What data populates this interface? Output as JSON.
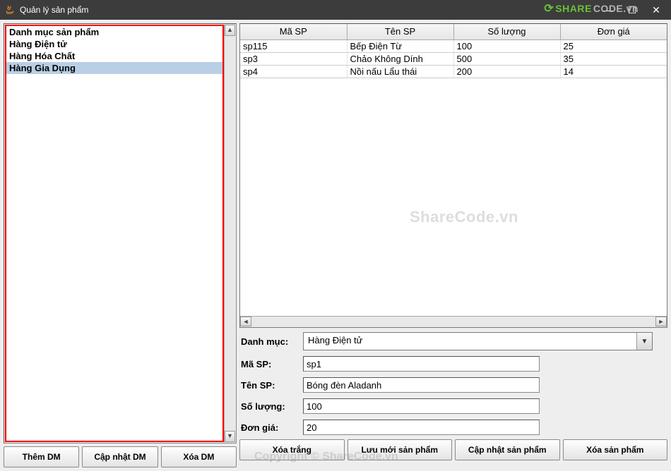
{
  "window": {
    "title": "Quản lý sản phẩm"
  },
  "categories": {
    "items": [
      {
        "label": "Danh mục sản phẩm",
        "selected": false
      },
      {
        "label": "Hàng Điện tử",
        "selected": false
      },
      {
        "label": "Hàng Hóa Chất",
        "selected": false
      },
      {
        "label": "Hàng Gia Dụng",
        "selected": true
      }
    ]
  },
  "left_buttons": {
    "add": "Thêm DM",
    "update": "Cập nhật DM",
    "delete": "Xóa DM"
  },
  "table": {
    "columns": [
      "Mã SP",
      "Tên SP",
      "Số lượng",
      "Đơn giá"
    ],
    "rows": [
      {
        "c0": "sp115",
        "c1": "Bếp Điện Từ",
        "c2": "100",
        "c3": "25"
      },
      {
        "c0": "sp3",
        "c1": "Chảo Không Dính",
        "c2": "500",
        "c3": "35"
      },
      {
        "c0": "sp4",
        "c1": "Nồi nấu Lẩu thái",
        "c2": "200",
        "c3": "14"
      }
    ]
  },
  "form": {
    "category_label": "Danh mục:",
    "category_value": "Hàng Điện tử",
    "code_label": "Mã SP:",
    "code_value": "sp1",
    "name_label": "Tên SP:",
    "name_value": "Bóng đèn Aladanh",
    "qty_label": "Số lượng:",
    "qty_value": "100",
    "price_label": "Đơn giá:",
    "price_value": "20"
  },
  "right_buttons": {
    "clear": "Xóa trắng",
    "save_new": "Lưu mới sản phẩm",
    "update": "Cập nhật sản phẩm",
    "delete": "Xóa sản phẩm"
  },
  "watermark": {
    "center": "ShareCode.vn",
    "bottom": "Copyright © ShareCode.vn",
    "logo1": "SHARE",
    "logo2": "CODE.vn"
  }
}
